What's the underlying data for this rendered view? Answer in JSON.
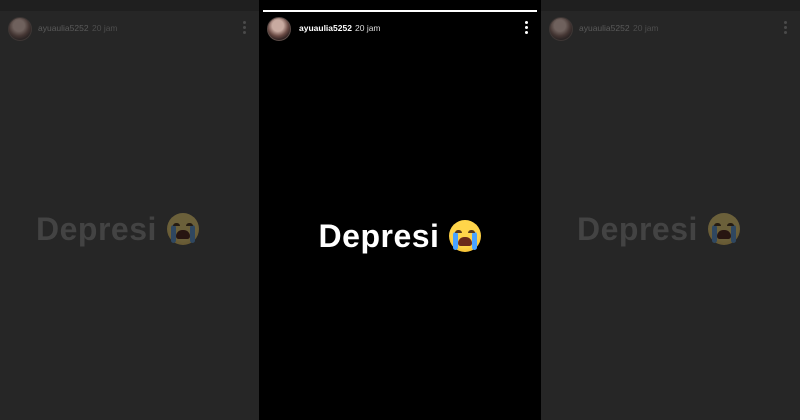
{
  "story": {
    "username": "ayuaulia5252",
    "time": "20 jam",
    "text": "Depresi",
    "emoji": "loudly-crying-face",
    "progress": 1.0
  },
  "colors": {
    "background_dim": "#262626",
    "story_background": "#000000",
    "text_primary": "#ffffff",
    "text_dim": "#434343"
  }
}
